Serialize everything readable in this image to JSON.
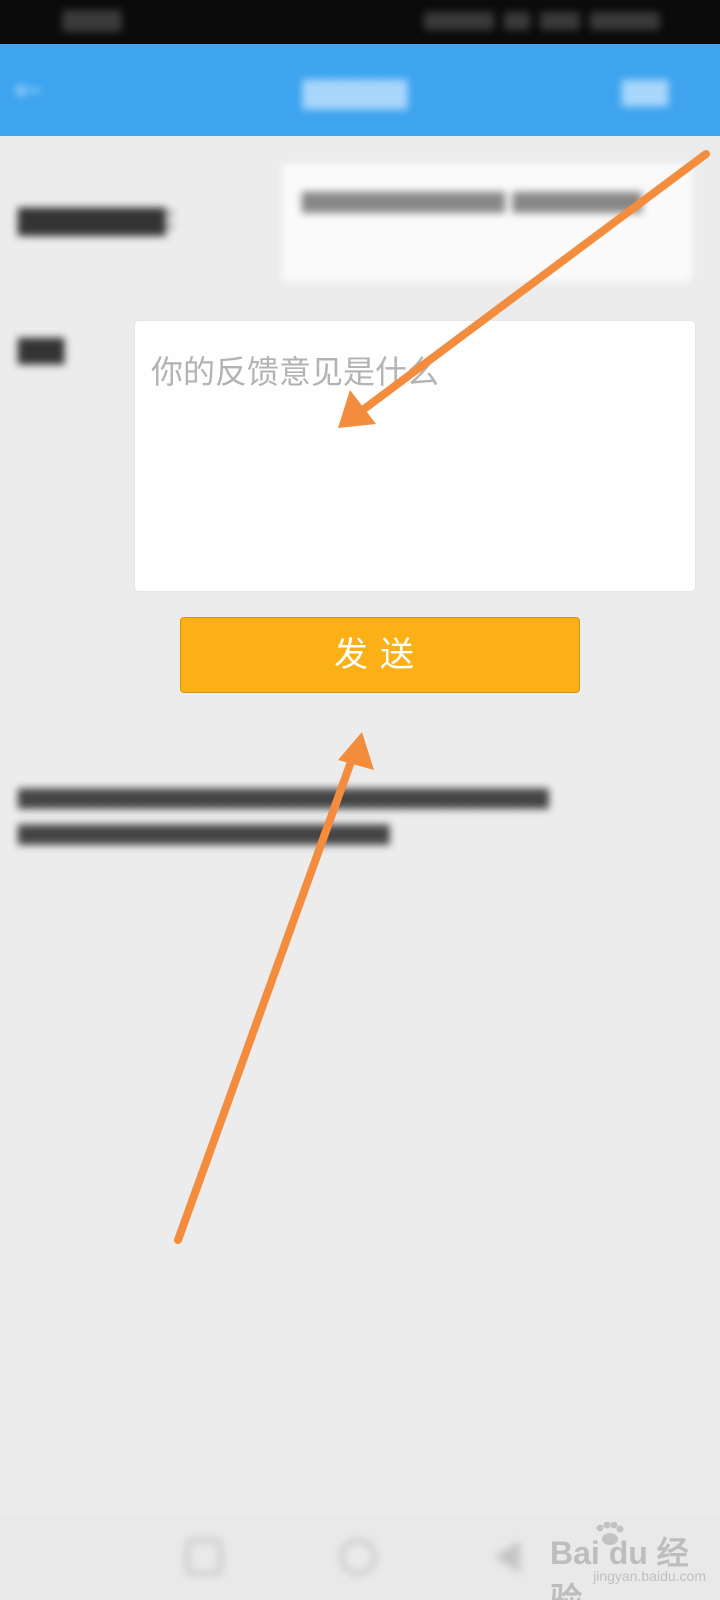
{
  "status_bar": {},
  "header": {
    "back_icon": "back-arrow-icon"
  },
  "form": {
    "content_placeholder": "你的反馈意见是什么"
  },
  "send_button": {
    "label": "发送"
  },
  "watermark": {
    "brand": "Bai du 经验",
    "url": "jingyan.baidu.com"
  },
  "colors": {
    "header": "#3ea4ef",
    "button": "#fbb018",
    "arrow": "#f38d3d",
    "background": "#ececec"
  }
}
